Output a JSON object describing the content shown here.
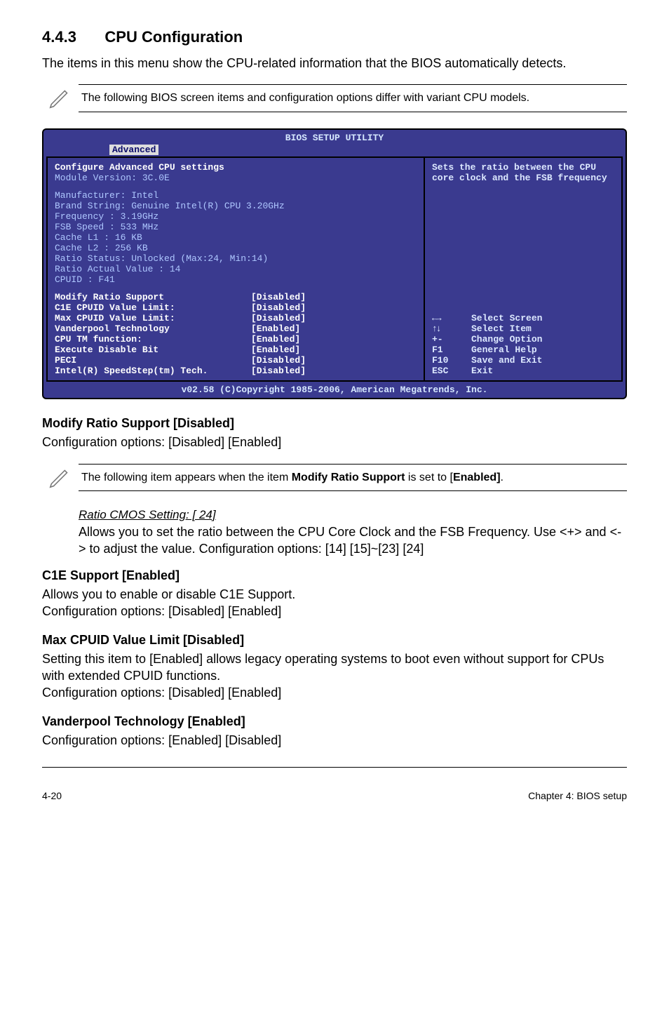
{
  "section": {
    "num": "4.4.3",
    "title": "CPU Configuration"
  },
  "intro": "The items in this menu show the CPU-related information that the BIOS automatically detects.",
  "note1": "The following BIOS screen items and configuration options differ with variant CPU models.",
  "bios": {
    "title": "BIOS SETUP UTILITY",
    "tab": "Advanced",
    "header1": "Configure Advanced CPU settings",
    "header2": "Module Version: 3C.0E",
    "info_lines": [
      "Manufacturer: Intel",
      "Brand String: Genuine Intel(R) CPU 3.20GHz",
      "Frequency   : 3.19GHz",
      "FSB Speed   : 533 MHz",
      "Cache L1    : 16 KB",
      "Cache L2    : 256 KB",
      "Ratio Status: Unlocked (Max:24, Min:14)",
      "Ratio Actual Value : 14",
      "CPUID       : F41"
    ],
    "items": [
      {
        "label": "Modify Ratio Support",
        "value": "[Disabled]"
      },
      {
        "label": "C1E CPUID Value Limit:",
        "value": "[Disabled]"
      },
      {
        "label": "Max CPUID Value Limit:",
        "value": "[Disabled]"
      },
      {
        "label": "Vanderpool Technology",
        "value": "[Enabled]"
      },
      {
        "label": "CPU TM function:",
        "value": "[Enabled]"
      },
      {
        "label": "Execute Disable Bit",
        "value": "[Enabled]"
      },
      {
        "label": "PECI",
        "value": "[Disabled]"
      },
      {
        "label": "Intel(R) SpeedStep(tm) Tech.",
        "value": "[Disabled]"
      }
    ],
    "right_top": "Sets the ratio between the CPU core clock and the FSB frequency",
    "hints": [
      {
        "key": "←→",
        "txt": "Select Screen"
      },
      {
        "key": "↑↓",
        "txt": "Select Item"
      },
      {
        "key": "+-",
        "txt": "Change Option"
      },
      {
        "key": "F1",
        "txt": "General Help"
      },
      {
        "key": "F10",
        "txt": "Save and Exit"
      },
      {
        "key": "ESC",
        "txt": "Exit"
      }
    ],
    "footer": "v02.58 (C)Copyright 1985-2006, American Megatrends, Inc."
  },
  "h_modify": "Modify Ratio Support [Disabled]",
  "modify_body": "Configuration options: [Disabled] [Enabled]",
  "note2_pre": "The following item appears when the item ",
  "note2_bold": "Modify Ratio Support",
  "note2_mid": " is set to [",
  "note2_bold2": "Enabled]",
  "note2_post": ".",
  "ratio_title": "Ratio CMOS Setting: [ 24]",
  "ratio_body": "Allows you to set the ratio between the CPU Core Clock and the FSB Frequency. Use <+> and <-> to adjust the value. Configuration options: [14] [15]~[23] [24]",
  "h_c1e": "C1E Support [Enabled]",
  "c1e_body": "Allows you to enable or disable C1E Support.\nConfiguration options:  [Disabled] [Enabled]",
  "h_max": "Max CPUID Value Limit [Disabled]",
  "max_body": "Setting this item to [Enabled] allows legacy operating systems to boot even without support for CPUs with extended CPUID functions.\nConfiguration options: [Disabled] [Enabled]",
  "h_van": "Vanderpool Technology [Enabled]",
  "van_body": "Configuration options: [Enabled] [Disabled]",
  "footer_left": "4-20",
  "footer_right": "Chapter 4: BIOS setup"
}
